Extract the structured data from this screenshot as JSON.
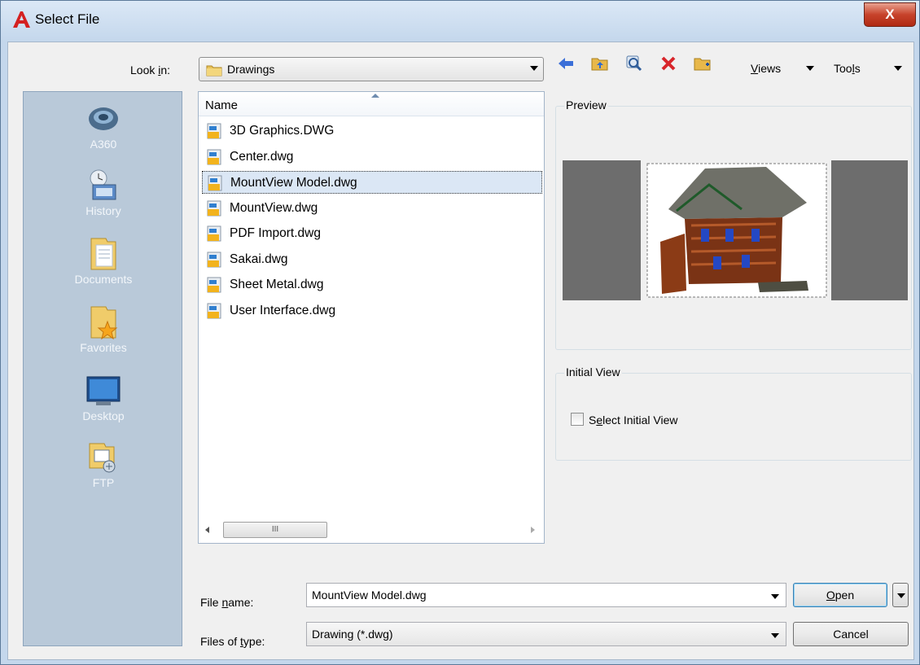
{
  "window": {
    "title": "Select File",
    "close_label": "X"
  },
  "look_in": {
    "label_pre": "Look ",
    "label_key": "i",
    "label_post": "n:",
    "value": "Drawings"
  },
  "toolbar": {
    "buttons": [
      "back-icon",
      "up-folder-icon",
      "search-web-icon",
      "delete-icon",
      "new-folder-icon"
    ],
    "views_key": "V",
    "views_rest": "iews",
    "tools_pre": "Too",
    "tools_key": "l",
    "tools_post": "s"
  },
  "places": [
    {
      "label": "A360",
      "icon": "a360-icon"
    },
    {
      "label": "History",
      "icon": "history-icon"
    },
    {
      "label": "Documents",
      "icon": "documents-folder-icon"
    },
    {
      "label": "Favorites",
      "icon": "favorites-folder-icon"
    },
    {
      "label": "Desktop",
      "icon": "desktop-monitor-icon"
    },
    {
      "label": "FTP",
      "icon": "ftp-icon"
    }
  ],
  "file_list": {
    "column_header": "Name",
    "files": [
      "3D Graphics.DWG",
      "Center.dwg",
      "MountView Model.dwg",
      "MountView.dwg",
      "PDF Import.dwg",
      "Sakai.dwg",
      "Sheet Metal.dwg",
      "User Interface.dwg"
    ],
    "selected_index": 2,
    "scroll_thumb_glyph": "III"
  },
  "preview": {
    "caption": "Preview"
  },
  "initial_view": {
    "caption": "Initial View",
    "checkbox_pre": "S",
    "checkbox_key": "e",
    "checkbox_post": "lect Initial View",
    "checked": false
  },
  "file_name": {
    "label_pre": "File ",
    "label_key": "n",
    "label_post": "ame:",
    "value": "MountView Model.dwg"
  },
  "files_of_type": {
    "label_pre": "Files of ",
    "label_key": "t",
    "label_post": "ype:",
    "value": "Drawing (*.dwg)"
  },
  "buttons": {
    "open_key": "O",
    "open_rest": "pen",
    "cancel": "Cancel"
  },
  "colors": {
    "accent": "#c4d7ec",
    "close": "#c7432b",
    "places_bg": "#b9c9d9"
  }
}
